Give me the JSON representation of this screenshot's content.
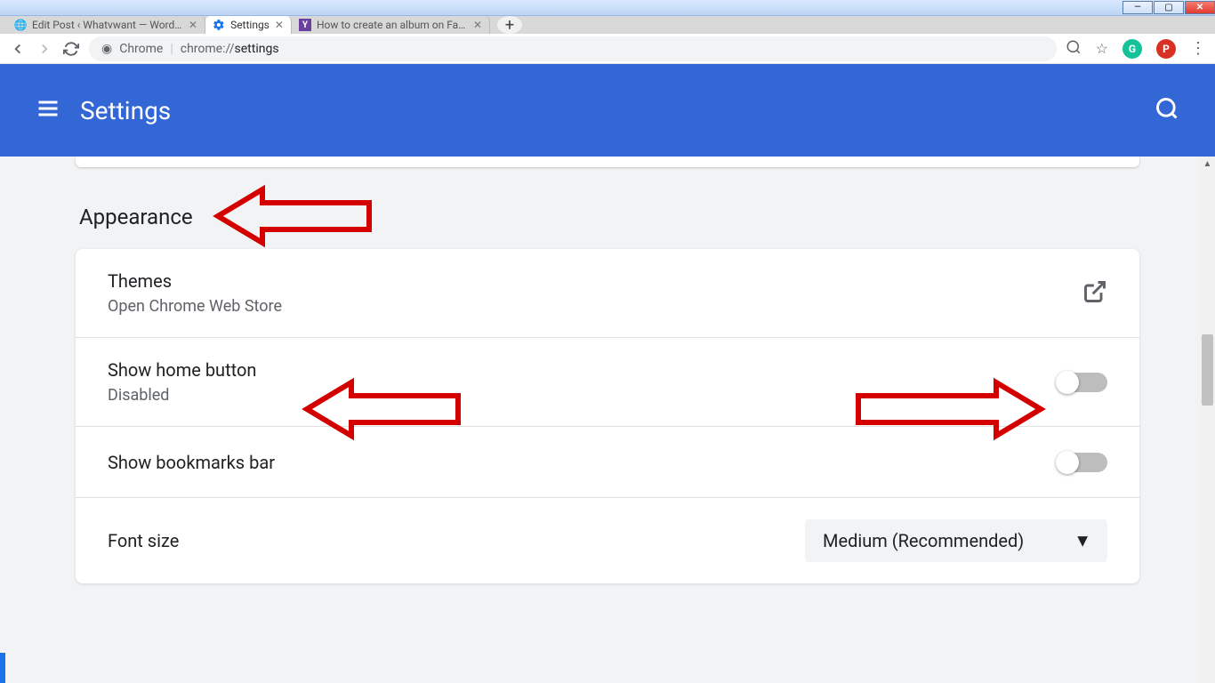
{
  "window": {
    "tabs": [
      {
        "title": "Edit Post ‹ Whatvwant — WordP…",
        "active": false
      },
      {
        "title": "Settings",
        "active": true
      },
      {
        "title": "How to create an album on Face…",
        "active": false
      }
    ]
  },
  "toolbar": {
    "scheme_label": "Chrome",
    "url_prefix": "chrome://",
    "url_path": "settings"
  },
  "header": {
    "title": "Settings"
  },
  "appearance": {
    "section_title": "Appearance",
    "rows": {
      "themes": {
        "title": "Themes",
        "sub": "Open Chrome Web Store"
      },
      "home": {
        "title": "Show home button",
        "sub": "Disabled"
      },
      "bookmarks": {
        "title": "Show bookmarks bar"
      },
      "font": {
        "title": "Font size",
        "value": "Medium (Recommended)"
      }
    }
  }
}
